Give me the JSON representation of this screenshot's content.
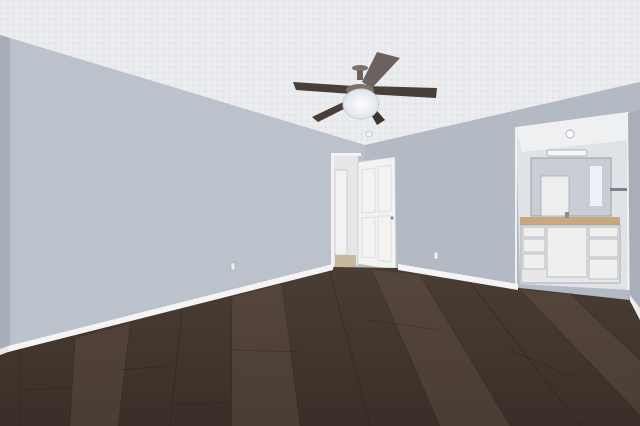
{
  "scene": {
    "kind": "photo",
    "subject": "empty bedroom",
    "colors": {
      "ceiling": "#e9ebee",
      "wall_left": "#bcc2cb",
      "wall_back": "#b4bac3",
      "wall_right": "#a9afb8",
      "baseboard": "#f4f4f4",
      "floor_dark": "#3a3029",
      "floor_mid": "#54463c",
      "floor_light": "#6b5a4c",
      "door": "#f3f3f1",
      "fan_blade": "#4a3e39",
      "fan_light": "#fbfbff",
      "vanity": "#e6e7e6",
      "countertop": "#c9a77f"
    }
  }
}
